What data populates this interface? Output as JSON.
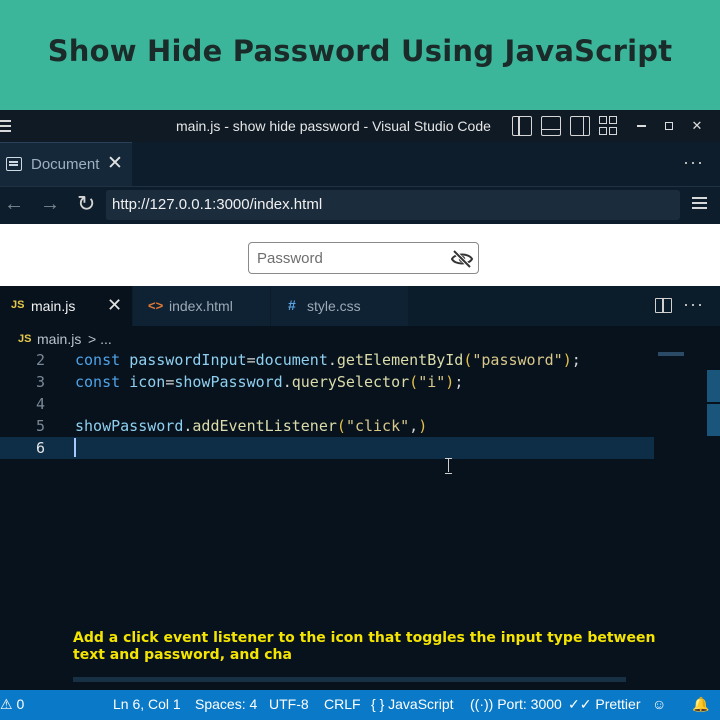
{
  "banner": {
    "title": "Show Hide Password Using JavaScript"
  },
  "window": {
    "title": "main.js - show hide password - Visual Studio Code"
  },
  "browser": {
    "tab_label": "Document",
    "url": "http://127.0.0.1:3000/index.html"
  },
  "preview": {
    "password_placeholder": "Password"
  },
  "editor_tabs": [
    {
      "icon": "JS",
      "label": "main.js",
      "active": true
    },
    {
      "icon": "<>",
      "label": "index.html",
      "active": false
    },
    {
      "icon": "#",
      "label": "style.css",
      "active": false
    }
  ],
  "breadcrumb": {
    "file": "main.js",
    "rest": "> ..."
  },
  "code": {
    "lines": [
      {
        "num": "2",
        "text": "const passwordInput=document.getElementById(\"password\");"
      },
      {
        "num": "3",
        "text": "const icon=showPassword.querySelector(\"i\");"
      },
      {
        "num": "4",
        "text": ""
      },
      {
        "num": "5",
        "text": "showPassword.addEventListener(\"click\",)"
      },
      {
        "num": "6",
        "text": ""
      }
    ],
    "current_line": "6"
  },
  "caption": "Add a click event listener to the icon that toggles the input type between text and password, and cha",
  "status": {
    "errors": "0",
    "position": "Ln 6, Col 1",
    "spaces": "Spaces: 4",
    "encoding": "UTF-8",
    "eol": "CRLF",
    "language": "JavaScript",
    "port": "Port: 3000",
    "formatter": "Prettier"
  },
  "colors": {
    "banner_bg": "#3cb69a",
    "statusbar_bg": "#0a7ac8",
    "editor_bg": "#07121d",
    "caption": "#f4e400"
  }
}
